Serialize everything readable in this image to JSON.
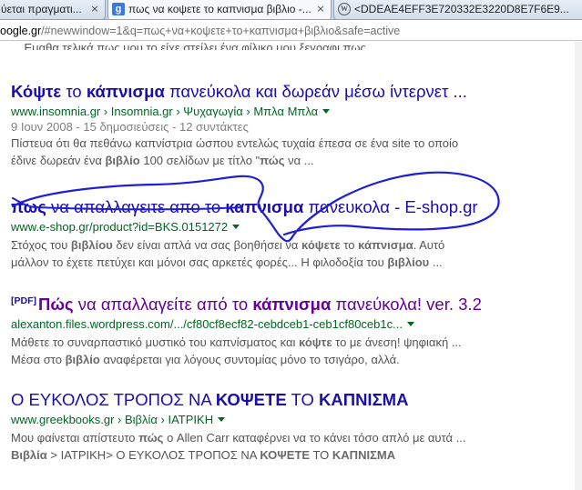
{
  "browser": {
    "tabs": [
      {
        "label": "ύεται πραγματι...",
        "icon": "none",
        "active": false,
        "close": "×"
      },
      {
        "label": "πως να κοψετε το καπνισμα βιβλιο -...",
        "icon": "google-favicon",
        "active": true,
        "close": "×"
      },
      {
        "label": "<DDEAE4EFF3E720332E3220D8E7F6E9...",
        "icon": "wordpress-favicon",
        "active": false,
        "close": "×"
      }
    ],
    "address": {
      "host": "oogle.gr",
      "path": "/#newwindow=1&q=πως+να+κοψετε+το+καπνισμα+βιβλιο&safe=active"
    }
  },
  "results": {
    "cutoff_text": "... Εμαθα τελικά πως μου το είχε στείλει ένα φίλικο μου ξεγραφι πως ...",
    "items": [
      {
        "title": [
          [
            "Κόψτε",
            true
          ],
          [
            " το ",
            false
          ],
          [
            "κάπνισμα",
            true
          ],
          [
            " πανεύκολα και δωρεάν μέσω ίντερνετ ...",
            false
          ]
        ],
        "visited": false,
        "pdf": "",
        "cite": "www.insomnia.gr › Insomnia.gr › Ψυχαγωγία › Μπλα Μπλα",
        "meta": "9 Ιουν 2008 - 15 δημοσιεύσεις - 12 συντάκτες",
        "snippet": [
          [
            [
              "Πίστευα ότι θα πεθάνω καπνίστρια ώσπου εντελώς τυχαία έπεσα σε ένα site το οποίο",
              false
            ]
          ],
          [
            [
              "έδινε δωρεάν ένα ",
              false
            ],
            [
              "βιβλίο",
              true
            ],
            [
              " 100 σελίδων με τίτλο \"",
              false
            ],
            [
              "πώς",
              true
            ],
            [
              " να ...",
              false
            ]
          ]
        ]
      },
      {
        "title": [
          [
            "πως",
            true
          ],
          [
            " να απαλλαγειτε απο το ",
            false
          ],
          [
            "καπνισμα",
            true
          ],
          [
            " πανευκολα - E-shop.gr",
            false
          ]
        ],
        "visited": false,
        "pdf": "",
        "cite": "www.e-shop.gr/product?id=BKS.0151272",
        "meta": "",
        "snippet": [
          [
            [
              "Στόχος του ",
              false
            ],
            [
              "βιβλίου",
              true
            ],
            [
              " δεν είναι απλά να σας βοηθήσει να ",
              false
            ],
            [
              "κόψετε",
              true
            ],
            [
              " το ",
              false
            ],
            [
              "κάπνισμα",
              true
            ],
            [
              ". Αυτό",
              false
            ]
          ],
          [
            [
              "μάλλον το έχετε πετύχει και μόνοι σας αρκετές φορές... Η φιλοδοξία του ",
              false
            ],
            [
              "βιβλίου",
              true
            ],
            [
              " ...",
              false
            ]
          ]
        ]
      },
      {
        "title": [
          [
            "Πώς",
            true
          ],
          [
            " να απαλλαγείτε από το ",
            false
          ],
          [
            "κάπνισμα",
            true
          ],
          [
            " πανεύκολα! ver. 3.2",
            false
          ]
        ],
        "visited": true,
        "pdf": "[PDF]",
        "cite": "alexanton.files.wordpress.com/.../cf80cf8ecf82-cebdceb1-ceb1cf80ceb1c...",
        "meta": "",
        "snippet": [
          [
            [
              "Μάθετε το συναρπαστικό μυστικό του καπνίσματος και ",
              false
            ],
            [
              "κόψτε",
              true
            ],
            [
              " το με άνεση! ψηφιακή ...",
              false
            ]
          ],
          [
            [
              "Μέσα στο ",
              false
            ],
            [
              "βιβλίο",
              true
            ],
            [
              " αναφέρεται για λόγους συντομίας μόνο το τσιγάρο, αλλά.",
              false
            ]
          ]
        ]
      },
      {
        "title": [
          [
            "Ο ΕΥΚΟΛΟΣ ΤΡΟΠΟΣ ΝΑ ",
            false
          ],
          [
            "ΚΟΨΕΤΕ",
            true
          ],
          [
            " ΤΟ ",
            false
          ],
          [
            "ΚΑΠΝΙΣΜΑ",
            true
          ]
        ],
        "visited": false,
        "pdf": "",
        "cite": "www.greekbooks.gr › Βιβλία › ΙΑΤΡΙΚΗ",
        "meta": "",
        "snippet": [
          [
            [
              "Μου φαίνεται απίστευτο ",
              false
            ],
            [
              "πώς",
              true
            ],
            [
              " ο Allen Carr καταφέρνει να το κάνει τόσο απλό με αυτά ...",
              false
            ]
          ],
          [
            [
              "Βιβλία",
              true
            ],
            [
              " > ΙΑΤΡΙΚΗ> Ο ΕΥΚΟΛΟΣ ΤΡΟΠΟΣ ΝΑ ",
              false
            ],
            [
              "ΚΟΨΕΤΕ",
              true
            ],
            [
              " ΤΟ ",
              false
            ],
            [
              "ΚΑΠΝΙΣΜΑ",
              true
            ]
          ]
        ]
      }
    ]
  },
  "colors": {
    "link": "#1a0dab",
    "visited": "#660099",
    "cite": "#006621",
    "snippet": "#545454",
    "meta": "#808080",
    "annotation": "#1d1fd6"
  }
}
